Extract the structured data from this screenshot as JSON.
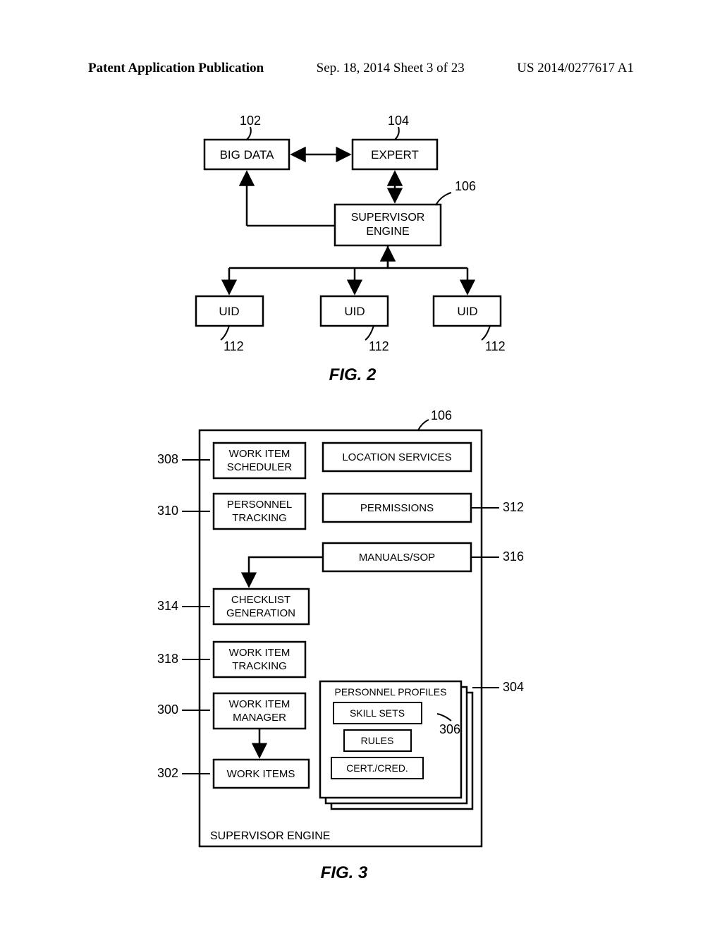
{
  "header": {
    "left": "Patent Application Publication",
    "mid": "Sep. 18, 2014  Sheet 3 of 23",
    "right": "US 2014/0277617 A1"
  },
  "fig2": {
    "title": "FIG. 2",
    "refs": {
      "bigdata": "102",
      "expert": "104",
      "engine": "106",
      "uid1": "112",
      "uid2": "112",
      "uid3": "112"
    },
    "boxes": {
      "bigdata": "BIG DATA",
      "expert": "EXPERT",
      "engine_l1": "SUPERVISOR",
      "engine_l2": "ENGINE",
      "uid": "UID"
    }
  },
  "fig3": {
    "title": "FIG. 3",
    "refs": {
      "engine": "106",
      "work_items": "302",
      "wim": "300",
      "wit": "318",
      "check": "314",
      "pers_track": "310",
      "sched": "308",
      "loc": "",
      "perm": "312",
      "man": "316",
      "profiles": "304",
      "rules_grp": "306"
    },
    "boxes": {
      "engine_label": "SUPERVISOR ENGINE",
      "work_items": "WORK ITEMS",
      "wim_l1": "WORK ITEM",
      "wim_l2": "MANAGER",
      "wit_l1": "WORK ITEM",
      "wit_l2": "TRACKING",
      "check_l1": "CHECKLIST",
      "check_l2": "GENERATION",
      "pers_l1": "PERSONNEL",
      "pers_l2": "TRACKING",
      "sched_l1": "WORK ITEM",
      "sched_l2": "SCHEDULER",
      "loc": "LOCATION SERVICES",
      "perm": "PERMISSIONS",
      "man": "MANUALS/SOP",
      "profiles": "PERSONNEL PROFILES",
      "skill": "SKILL SETS",
      "rules": "RULES",
      "cert": "CERT./CRED."
    },
    "left_refs": {
      "r308": "308",
      "r310": "310",
      "r314": "314",
      "r318": "318",
      "r300": "300",
      "r302": "302"
    },
    "right_refs": {
      "r312": "312",
      "r316": "316",
      "r304": "304",
      "r306": "306"
    }
  },
  "chart_data": {
    "type": "diagram",
    "figures": [
      {
        "name": "FIG. 2",
        "nodes": [
          {
            "id": "102",
            "label": "BIG DATA"
          },
          {
            "id": "104",
            "label": "EXPERT"
          },
          {
            "id": "106",
            "label": "SUPERVISOR ENGINE"
          },
          {
            "id": "112a",
            "label": "UID"
          },
          {
            "id": "112b",
            "label": "UID"
          },
          {
            "id": "112c",
            "label": "UID"
          }
        ],
        "edges": [
          {
            "from": "102",
            "to": "104",
            "dir": "both"
          },
          {
            "from": "104",
            "to": "106",
            "dir": "both"
          },
          {
            "from": "102",
            "to": "106",
            "dir": "to"
          },
          {
            "from": "106",
            "to": "112a",
            "dir": "both"
          },
          {
            "from": "106",
            "to": "112b",
            "dir": "both"
          },
          {
            "from": "106",
            "to": "112c",
            "dir": "both"
          }
        ]
      },
      {
        "name": "FIG. 3",
        "container": {
          "id": "106",
          "label": "SUPERVISOR ENGINE"
        },
        "components": [
          {
            "id": "308",
            "label": "WORK ITEM SCHEDULER"
          },
          {
            "id": "310",
            "label": "PERSONNEL TRACKING"
          },
          {
            "id": "314",
            "label": "CHECKLIST GENERATION"
          },
          {
            "id": "318",
            "label": "WORK ITEM TRACKING"
          },
          {
            "id": "300",
            "label": "WORK ITEM MANAGER"
          },
          {
            "id": "302",
            "label": "WORK ITEMS"
          },
          {
            "id": "",
            "label": "LOCATION SERVICES"
          },
          {
            "id": "312",
            "label": "PERMISSIONS"
          },
          {
            "id": "316",
            "label": "MANUALS/SOP"
          },
          {
            "id": "304",
            "label": "PERSONNEL PROFILES",
            "children": [
              {
                "id": "306",
                "label": "SKILL SETS"
              },
              {
                "id": "306",
                "label": "RULES"
              },
              {
                "id": "306",
                "label": "CERT./CRED."
              }
            ]
          }
        ],
        "edges": [
          {
            "from": "316",
            "to": "314"
          },
          {
            "from": "300",
            "to": "302"
          }
        ]
      }
    ]
  }
}
